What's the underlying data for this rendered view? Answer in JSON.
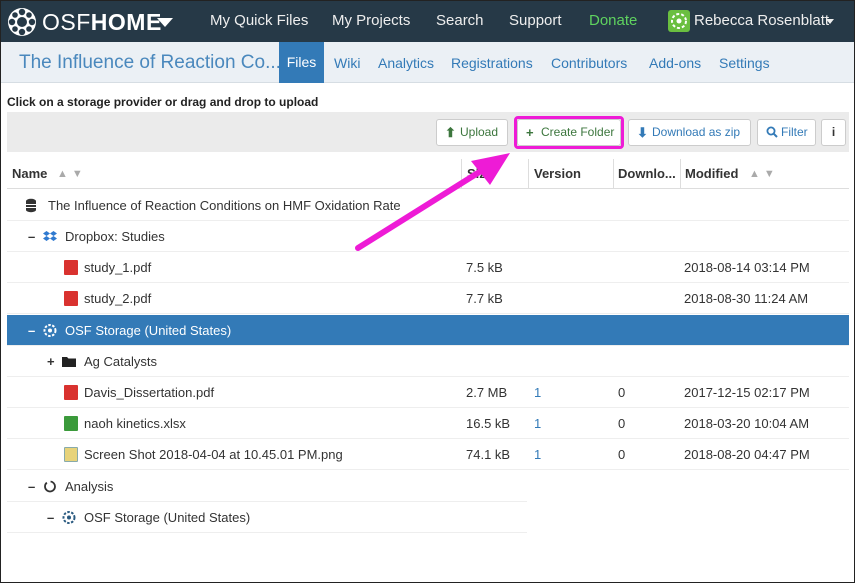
{
  "nav": {
    "brand_light": "OSF",
    "brand_bold": "HOME",
    "links": [
      "My Quick Files",
      "My Projects",
      "Search",
      "Support",
      "Donate"
    ],
    "user": "Rebecca Rosenblatt"
  },
  "project": {
    "title": "The Influence of Reaction Co...",
    "tabs": [
      "Files",
      "Wiki",
      "Analytics",
      "Registrations",
      "Contributors",
      "Add-ons",
      "Settings"
    ],
    "active_tab": "Files"
  },
  "instructions": "Click on a storage provider or drag and drop to upload",
  "toolbar": {
    "upload": "Upload",
    "create_folder": "Create Folder",
    "download_zip": "Download as zip",
    "filter": "Filter",
    "info": "i"
  },
  "columns": {
    "name": "Name",
    "size": "Size",
    "version": "Version",
    "downloads": "Downlo...",
    "modified": "Modified"
  },
  "rows": [
    {
      "name": "The Influence of Reaction Conditions on HMF Oxidation Rate",
      "toggle": "",
      "icon": "database-icon",
      "size": "",
      "version": "",
      "downloads": "",
      "modified": ""
    },
    {
      "name": "Dropbox: Studies",
      "toggle": "–",
      "icon": "dropbox-icon",
      "size": "",
      "version": "",
      "downloads": "",
      "modified": ""
    },
    {
      "name": "study_1.pdf",
      "toggle": "",
      "icon": "pdf-file-icon",
      "size": "7.5 kB",
      "version": "",
      "downloads": "",
      "modified": "2018-08-14 03:14 PM"
    },
    {
      "name": "study_2.pdf",
      "toggle": "",
      "icon": "pdf-file-icon",
      "size": "7.7 kB",
      "version": "",
      "downloads": "",
      "modified": "2018-08-30 11:24 AM"
    },
    {
      "name": "OSF Storage (United States)",
      "toggle": "–",
      "icon": "osf-storage-icon",
      "size": "",
      "version": "",
      "downloads": "",
      "modified": ""
    },
    {
      "name": "Ag Catalysts",
      "toggle": "+",
      "icon": "folder-icon",
      "size": "",
      "version": "",
      "downloads": "",
      "modified": ""
    },
    {
      "name": "Davis_Dissertation.pdf",
      "toggle": "",
      "icon": "pdf-file-icon",
      "size": "2.7 MB",
      "version": "1",
      "downloads": "0",
      "modified": "2017-12-15 02:17 PM"
    },
    {
      "name": "naoh kinetics.xlsx",
      "toggle": "",
      "icon": "excel-file-icon",
      "size": "16.5 kB",
      "version": "1",
      "downloads": "0",
      "modified": "2018-03-20 10:04 AM"
    },
    {
      "name": "Screen Shot 2018-04-04 at 10.45.01 PM.png",
      "toggle": "",
      "icon": "image-file-icon",
      "size": "74.1 kB",
      "version": "1",
      "downloads": "0",
      "modified": "2018-08-20 04:47 PM"
    },
    {
      "name": "Analysis",
      "toggle": "–",
      "icon": "component-icon",
      "size": "",
      "version": "",
      "downloads": "",
      "modified": ""
    },
    {
      "name": "OSF Storage (United States)",
      "toggle": "–",
      "icon": "osf-storage-icon",
      "size": "",
      "version": "",
      "downloads": "",
      "modified": ""
    }
  ],
  "colors": {
    "navbar": "#263947",
    "subnav": "#ebf0f5",
    "accent": "#337ab7",
    "donate": "#5fd35f",
    "annotation": "#ee1bd6"
  }
}
